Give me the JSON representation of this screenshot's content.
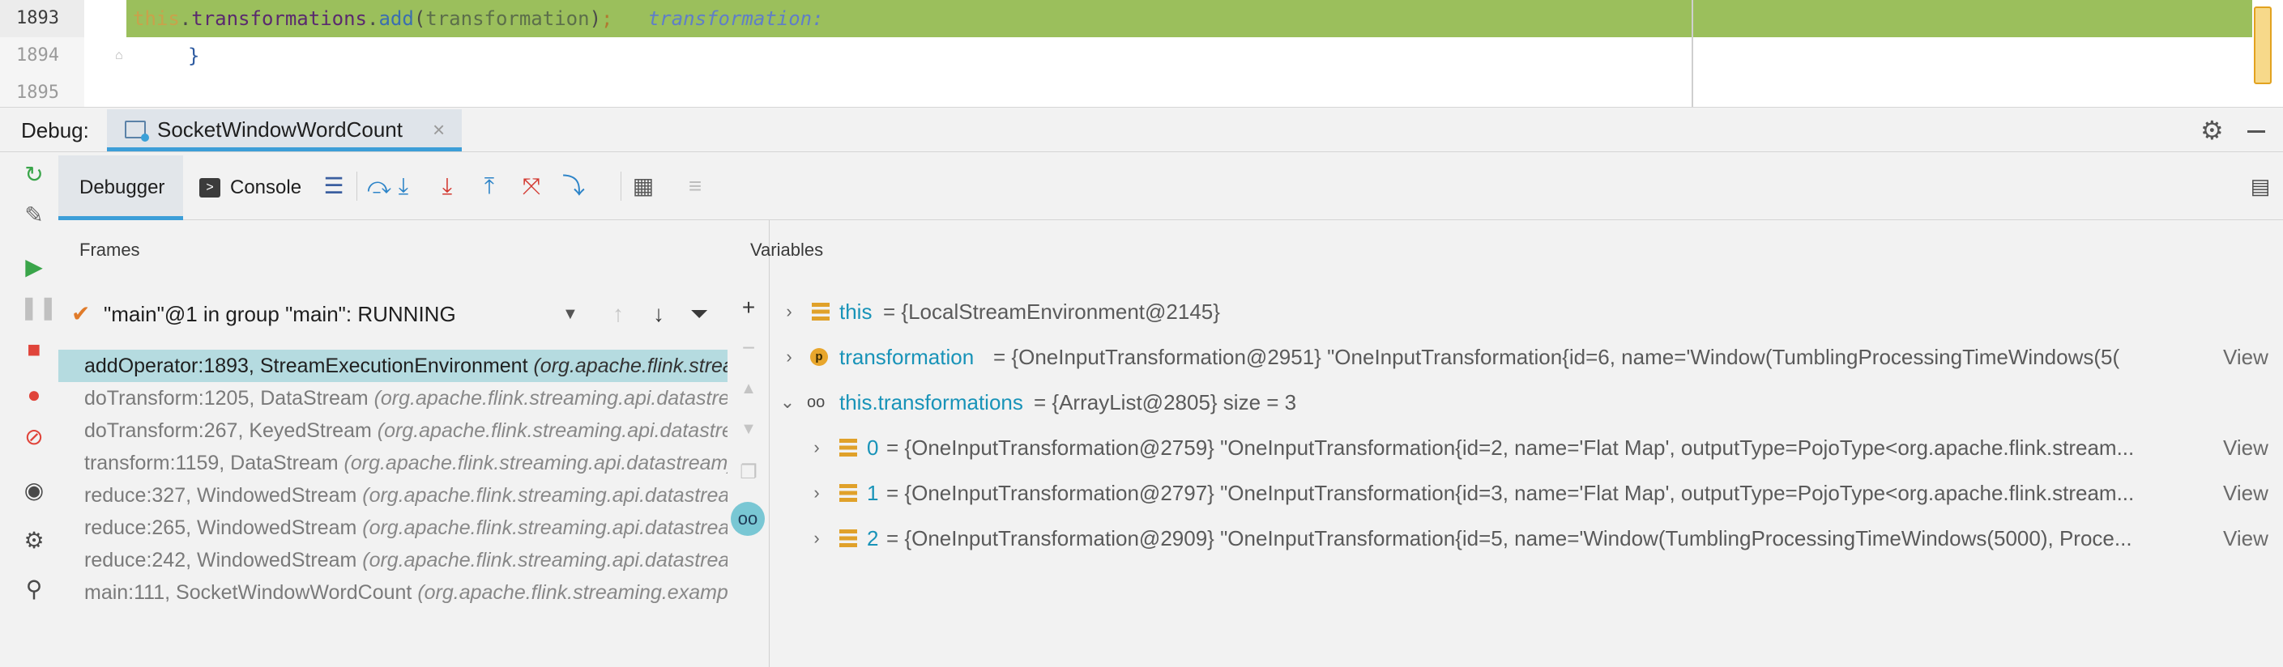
{
  "editor": {
    "lines": [
      {
        "num": "1893",
        "code": {
          "this": "this",
          "dot1": ".",
          "field": "transformations",
          "dot2": ".",
          "method": "add",
          "lparen": "(",
          "param": "transformation",
          "rparen": ")",
          "semi": ";",
          "hint": "transformation: "
        }
      },
      {
        "num": "1894",
        "brace": "}"
      },
      {
        "num": "1895"
      }
    ]
  },
  "debug": {
    "label": "Debug:",
    "tab_label": "SocketWindowWordCount",
    "tab_close": "×"
  },
  "tabs": {
    "debugger": "Debugger",
    "console": "Console",
    "console_icon": ">"
  },
  "frames": {
    "title": "Frames",
    "thread": "\"main\"@1 in group \"main\": RUNNING",
    "items": [
      {
        "method": "addOperator:1893, StreamExecutionEnvironment ",
        "loc": "(org.apache.flink.streaming.api.environment)"
      },
      {
        "method": "doTransform:1205, DataStream ",
        "loc": "(org.apache.flink.streaming.api.datastream)"
      },
      {
        "method": "doTransform:267, KeyedStream ",
        "loc": "(org.apache.flink.streaming.api.datastream)"
      },
      {
        "method": "transform:1159, DataStream ",
        "loc": "(org.apache.flink.streaming.api.datastream)"
      },
      {
        "method": "reduce:327, WindowedStream ",
        "loc": "(org.apache.flink.streaming.api.datastream)"
      },
      {
        "method": "reduce:265, WindowedStream ",
        "loc": "(org.apache.flink.streaming.api.datastream)"
      },
      {
        "method": "reduce:242, WindowedStream ",
        "loc": "(org.apache.flink.streaming.api.datastream)"
      },
      {
        "method": "main:111, SocketWindowWordCount ",
        "loc": "(org.apache.flink.streaming.examples)"
      }
    ]
  },
  "variables": {
    "title": "Variables",
    "view_label": "View",
    "param_badge": "p",
    "watch_glyph": "oo",
    "items": [
      {
        "name": "this",
        "value": "= {LocalStreamEnvironment@2145}"
      },
      {
        "name": "transformation",
        "value": "= {OneInputTransformation@2951} \"OneInputTransformation{id=6, name='Window(TumblingProcessingTimeWindows(5("
      },
      {
        "name": "this.transformations",
        "value": "= {ArrayList@2805}  size = 3"
      },
      {
        "name": "0",
        "value": "= {OneInputTransformation@2759} \"OneInputTransformation{id=2, name='Flat Map', outputType=PojoType<org.apache.flink.stream..."
      },
      {
        "name": "1",
        "value": "= {OneInputTransformation@2797} \"OneInputTransformation{id=3, name='Flat Map', outputType=PojoType<org.apache.flink.stream..."
      },
      {
        "name": "2",
        "value": "= {OneInputTransformation@2909} \"OneInputTransformation{id=5, name='Window(TumblingProcessingTimeWindows(5000), Proce..."
      }
    ]
  },
  "colors": {
    "current_line": "#9bbf5c",
    "selected_frame": "#b5dbe0",
    "tab_underline": "#3c9ed8",
    "variable_name": "#1893b8"
  }
}
